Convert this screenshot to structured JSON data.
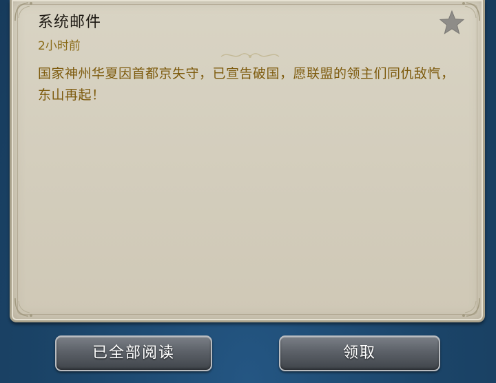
{
  "mail": {
    "title": "系统邮件",
    "time": "2小时前",
    "body": "国家神州华夏因首都京失守，已宣告破国，愿联盟的领主们同仇敌忾，东山再起！"
  },
  "buttons": {
    "read_all": "已全部阅读",
    "claim": "领取"
  },
  "icons": {
    "favorite": "star-icon"
  },
  "colors": {
    "background": "#1d4a72",
    "panel": "#d6d1c1",
    "body_text": "#7d5a0c",
    "time_text": "#8a6a16",
    "button": "#5c6168"
  }
}
